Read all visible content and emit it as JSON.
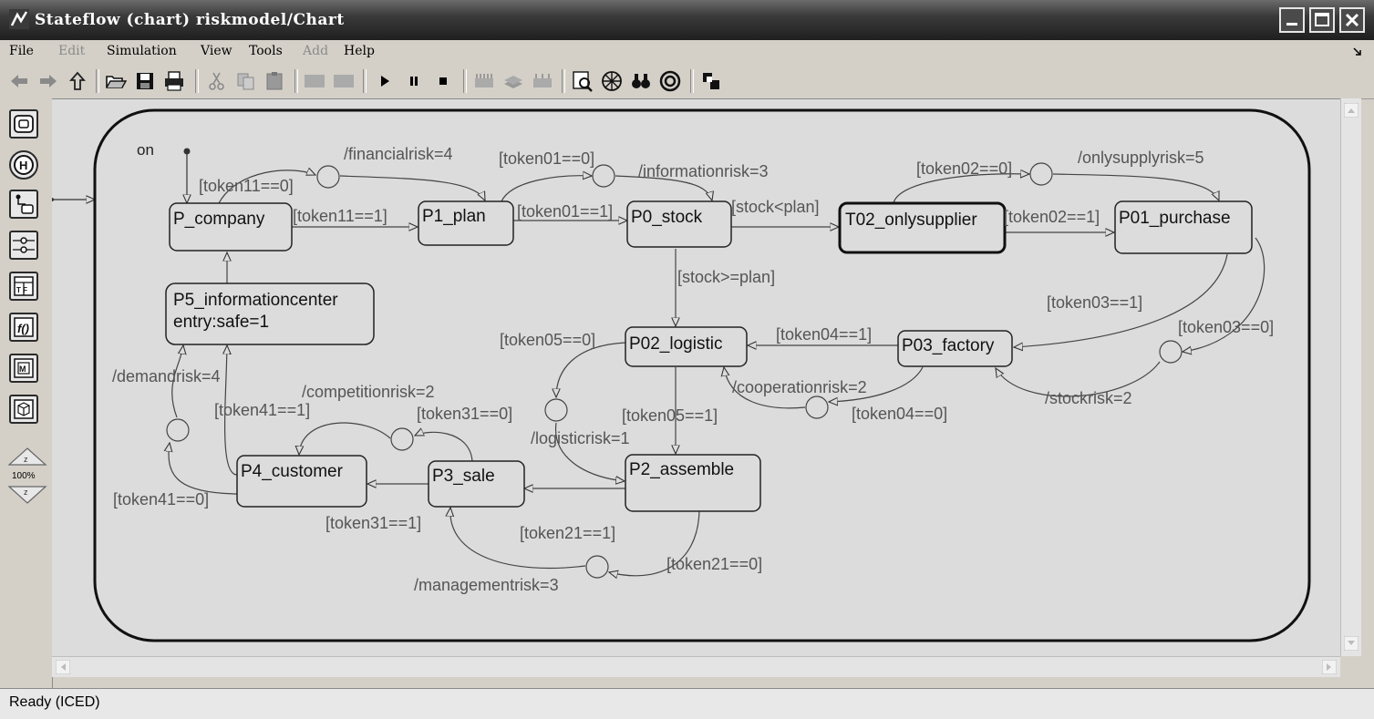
{
  "window": {
    "title": "Stateflow (chart) riskmodel/Chart"
  },
  "menu": {
    "items": [
      {
        "label": "File",
        "enabled": true
      },
      {
        "label": "Edit",
        "enabled": false
      },
      {
        "label": "Simulation",
        "enabled": true
      },
      {
        "label": "View",
        "enabled": true
      },
      {
        "label": "Tools",
        "enabled": true
      },
      {
        "label": "Add",
        "enabled": false
      },
      {
        "label": "Help",
        "enabled": true
      }
    ]
  },
  "palette": {
    "zoom": "100%"
  },
  "chart": {
    "superstate_label": "on",
    "states": [
      {
        "id": "P_company",
        "name": "P_company"
      },
      {
        "id": "P1_plan",
        "name": "P1_plan"
      },
      {
        "id": "P0_stock",
        "name": "P0_stock"
      },
      {
        "id": "T02_onlysupplier",
        "name": "T02_onlysupplier"
      },
      {
        "id": "P01_purchase",
        "name": "P01_purchase"
      },
      {
        "id": "P5_informationcenter",
        "name": "P5_informationcenter",
        "action": "entry:safe=1"
      },
      {
        "id": "P02_logistic",
        "name": "P02_logistic"
      },
      {
        "id": "P03_factory",
        "name": "P03_factory"
      },
      {
        "id": "P2_assemble",
        "name": "P2_assemble"
      },
      {
        "id": "P4_customer",
        "name": "P4_customer"
      },
      {
        "id": "P3_sale",
        "name": "P3_sale"
      }
    ],
    "labels": {
      "l_token11_0": "[token11==0]",
      "l_financialrisk": "/financialrisk=4",
      "l_token11_1": "[token11==1]",
      "l_token01_0": "[token01==0]",
      "l_informationrisk": "/informationrisk=3",
      "l_token01_1": "[token01==1]",
      "l_stock_lt_plan": "[stock<plan]",
      "l_token02_0": "[token02==0]",
      "l_onlysupplyrisk": "/onlysupplyrisk=5",
      "l_token02_1": "[token02==1]",
      "l_stock_ge_plan": "[stock>=plan]",
      "l_token03_1": "[token03==1]",
      "l_token03_0": "[token03==0]",
      "l_token05_0": "[token05==0]",
      "l_token04_1": "[token04==1]",
      "l_demandrisk": "/demandrisk=4",
      "l_cooperationrisk": "/cooperationrisk=2",
      "l_stockrisk": "/stockrisk=2",
      "l_competitionrisk": "/competitionrisk=2",
      "l_token41_1": "[token41==1]",
      "l_token31_0": "[token31==0]",
      "l_token05_1": "[token05==1]",
      "l_token04_0": "[token04==0]",
      "l_logisticrisk": "/logisticrisk=1",
      "l_token41_0": "[token41==0]",
      "l_token31_1": "[token31==1]",
      "l_token21_1": "[token21==1]",
      "l_token21_0": "[token21==0]",
      "l_managementrisk": "/managementrisk=3"
    }
  },
  "status": {
    "text": "Ready (ICED)"
  }
}
